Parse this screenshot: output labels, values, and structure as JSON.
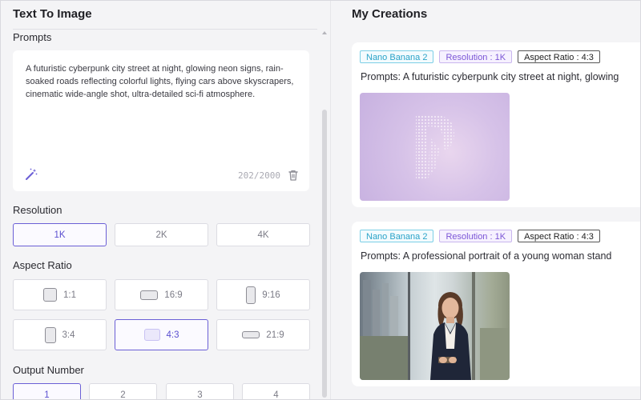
{
  "left_panel": {
    "title": "Text To Image",
    "prompts_label": "Prompts",
    "prompt_text": "A futuristic cyberpunk city street at night, glowing neon signs, rain-soaked roads reflecting colorful lights, flying cars above skyscrapers, cinematic wide-angle shot, ultra-detailed sci-fi atmosphere.",
    "char_count": "202/2000",
    "resolution_label": "Resolution",
    "resolutions": [
      "1K",
      "2K",
      "4K"
    ],
    "resolution_selected": "1K",
    "aspect_ratio_label": "Aspect Ratio",
    "aspect_ratios": [
      "1:1",
      "16:9",
      "9:16",
      "3:4",
      "4:3",
      "21:9"
    ],
    "aspect_ratio_selected": "4:3",
    "output_number_label": "Output Number",
    "output_numbers": [
      "1",
      "2",
      "3",
      "4"
    ],
    "output_number_selected": "1"
  },
  "right_panel": {
    "title": "My Creations",
    "creations": [
      {
        "model": "Nano Banana 2",
        "resolution": "Resolution : 1K",
        "aspect_ratio": "Aspect Ratio : 4:3",
        "prompt": "Prompts: A futuristic cyberpunk city street at night, glowing"
      },
      {
        "model": "Nano Banana 2",
        "resolution": "Resolution : 1K",
        "aspect_ratio": "Aspect Ratio : 4:3",
        "prompt": "Prompts: A professional portrait of a young woman stand"
      }
    ]
  },
  "colors": {
    "accent": "#6b5fd6",
    "panel_bg": "#f4f4f6",
    "tag_model": "#2aa3c8",
    "tag_resolution": "#7b55d6"
  },
  "icons": {
    "magic": "magic-wand-icon",
    "trash": "trash-icon",
    "scroll_up": "scroll-up-arrow-icon"
  }
}
